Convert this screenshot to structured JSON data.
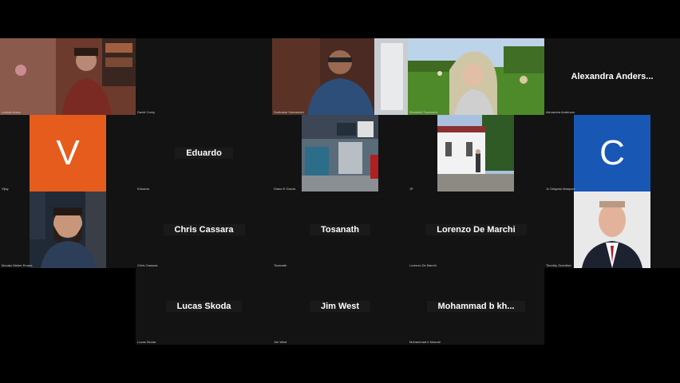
{
  "participants": {
    "lokesh": {
      "caption": "Lokesh Arora"
    },
    "david": {
      "caption": "David Corey"
    },
    "sudhakar": {
      "caption": "Sudhakar Subramani"
    },
    "elizabeth": {
      "caption": "Elizabeth Townsend"
    },
    "alexandra": {
      "center": "Alexandra  Anders...",
      "caption": "Alexandra Anderson"
    },
    "vijay": {
      "caption": "Vijay",
      "letter": "V",
      "color": "#e65c1c"
    },
    "eduardo": {
      "center": "Eduardo",
      "caption": "Eduardo"
    },
    "diana": {
      "caption": "Diana E Garcia"
    },
    "jp": {
      "caption": "JP"
    },
    "delgado": {
      "caption": "Jc Delgado Marquez",
      "letter": "C",
      "color": "#1957b5"
    },
    "moutaz": {
      "caption": "Moutaz Maher Emara"
    },
    "chris": {
      "center": "Chris Cassara",
      "caption": "Chris Cassara"
    },
    "tosanath": {
      "center": "Tosanath",
      "caption": "Tosanath"
    },
    "lorenzo": {
      "center": "Lorenzo De Marchi",
      "caption": "Lorenzo De Marchi"
    },
    "timothy": {
      "caption": "Timothy Guenther"
    },
    "lucas": {
      "center": "Lucas Skoda",
      "caption": "Lucas Skoda"
    },
    "jim": {
      "center": "Jim West",
      "caption": "Jim West"
    },
    "mohammad": {
      "center": "Mohammad  b  kh...",
      "caption": "Mohammad b Mosrati"
    }
  }
}
